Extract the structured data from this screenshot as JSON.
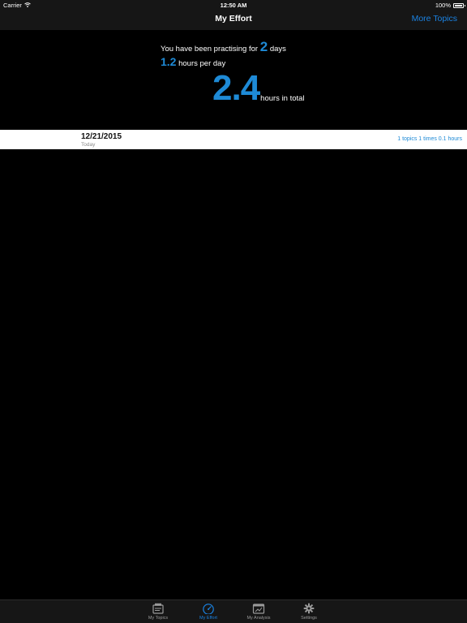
{
  "status_bar": {
    "carrier": "Carrier",
    "time": "12:50 AM",
    "battery": "100%",
    "battery_level": 1.0
  },
  "nav": {
    "title": "My Effort",
    "right_button": "More Topics"
  },
  "summary": {
    "line1_prefix": "You have been practising for",
    "days": "2",
    "line1_suffix": "days",
    "per_day": "1.2",
    "per_day_label": "hours per day",
    "total": "2.4",
    "total_label": "hours in total"
  },
  "log": [
    {
      "date": "12/21/2015",
      "subtitle": "Today",
      "detail": "1 topics 1 times 0.1 hours"
    }
  ],
  "tabs": [
    {
      "label": "My Topics",
      "icon": "topics-icon",
      "active": false
    },
    {
      "label": "My Effort",
      "icon": "gauge-icon",
      "active": true
    },
    {
      "label": "My Analysis",
      "icon": "calendar-chart-icon",
      "active": false
    },
    {
      "label": "Settings",
      "icon": "gear-icon",
      "active": false
    }
  ],
  "colors": {
    "accent": "#1a82e2",
    "bar_background": "#161616",
    "background": "#000000"
  }
}
